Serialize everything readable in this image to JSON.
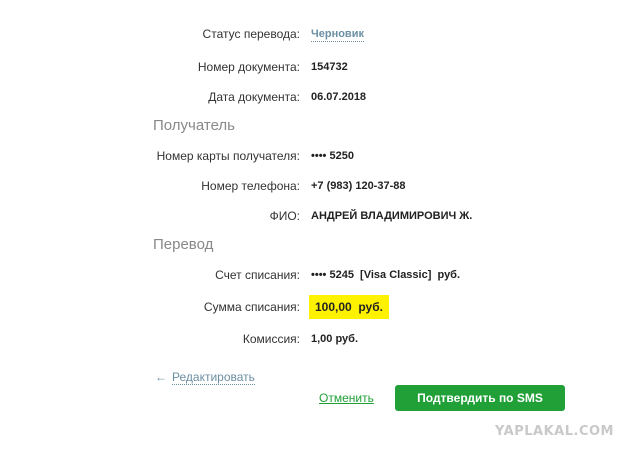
{
  "details": {
    "status": {
      "label": "Статус перевода:",
      "value": "Черновик"
    },
    "doc_number": {
      "label": "Номер документа:",
      "value": "154732"
    },
    "doc_date": {
      "label": "Дата документа:",
      "value": "06.07.2018"
    }
  },
  "recipient": {
    "heading": "Получатель",
    "card": {
      "label": "Номер карты получателя:",
      "value": "•••• 5250"
    },
    "phone": {
      "label": "Номер телефона:",
      "value": "+7 (983) 120-37-88"
    },
    "name": {
      "label": "ФИО:",
      "value": "АНДРЕЙ ВЛАДИМИРОВИЧ Ж."
    }
  },
  "transfer": {
    "heading": "Перевод",
    "account": {
      "label": "Счет списания:",
      "value": "•••• 5245  [Visa Classic]  руб."
    },
    "amount": {
      "label": "Сумма списания:",
      "value": "100,00  руб."
    },
    "fee": {
      "label": "Комиссия:",
      "value": "1,00 руб."
    }
  },
  "actions": {
    "edit_label": "Редактировать",
    "cancel_label": "Отменить",
    "confirm_label": "Подтвердить по SMS"
  },
  "watermark": "YAPLAKAL.COM",
  "colors": {
    "accent_green": "#21a038",
    "link_blue": "#6b8fa3",
    "highlight": "#fff200"
  }
}
